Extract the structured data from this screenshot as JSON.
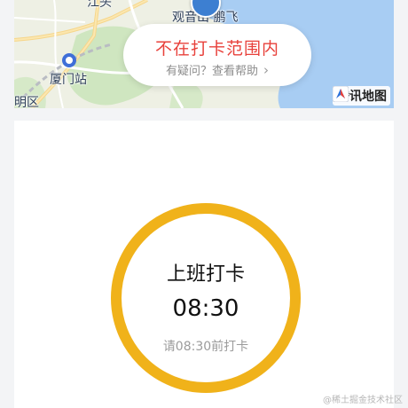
{
  "map": {
    "labels": {
      "jiangtou": "江头",
      "xiamen_station": "厦门站",
      "district": "思明区",
      "poi": "观音山 鹏飞"
    },
    "status_title": "不在打卡范围内",
    "status_help": "有疑问？查看帮助",
    "logo_text": "腾讯地图",
    "avatar_icon": "user-avatar-icon"
  },
  "clock": {
    "title": "上班打卡",
    "time": "08:30",
    "hint": "请08:30前打卡",
    "ring_color": "#f0b21a"
  },
  "colors": {
    "status_red": "#e8413b",
    "accent_orange": "#f0b21a"
  },
  "watermark": "@稀土掘金技术社区"
}
